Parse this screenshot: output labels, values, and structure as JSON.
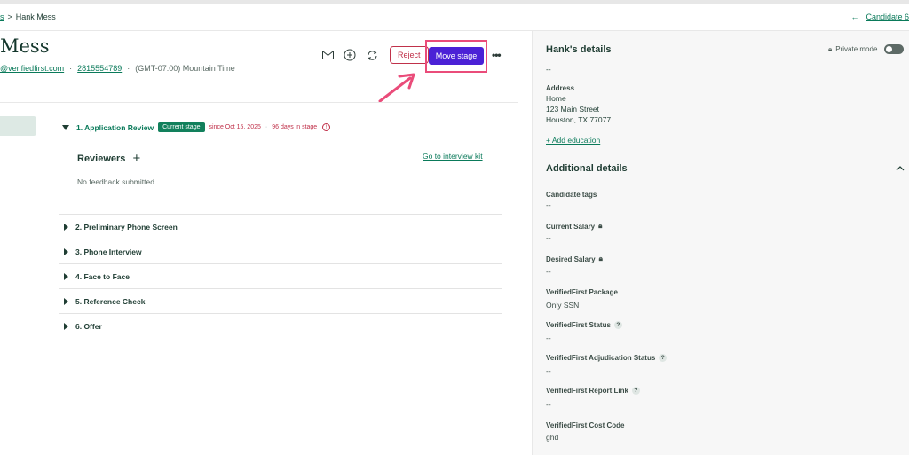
{
  "breadcrumb": {
    "parent": "s",
    "separator": ">",
    "current": "Hank Mess"
  },
  "next_candidate": {
    "label": "Candidate 6"
  },
  "candidate": {
    "name": "Mess",
    "email": "@verifiedfirst.com",
    "phone": "2815554789",
    "timezone": "(GMT-07:00) Mountain Time"
  },
  "actions": {
    "reject": "Reject",
    "move_stage": "Move stage",
    "more": "•••"
  },
  "stage": {
    "title": "1. Application Review",
    "badge": "Current stage",
    "since": "since Oct 15, 2025",
    "days": "96 days in stage",
    "info_symbol": "!"
  },
  "reviewers": {
    "label": "Reviewers",
    "add": "+",
    "kit_link": "Go to interview kit",
    "no_feedback": "No feedback submitted"
  },
  "stages": [
    "2. Preliminary Phone Screen",
    "3. Phone Interview",
    "4. Face to Face",
    "5. Reference Check",
    "6. Offer"
  ],
  "details": {
    "title": "Hank's details",
    "private_mode": "Private mode",
    "dash": "--",
    "address_label": "Address",
    "address_type": "Home",
    "address_line1": "123 Main Street",
    "address_line2": "Houston, TX 77077",
    "add_education": "+ Add education"
  },
  "additional": {
    "title": "Additional details",
    "fields": [
      {
        "label": "Candidate tags",
        "value": "--"
      },
      {
        "label": "Current Salary",
        "value": "--"
      },
      {
        "label": "Desired Salary",
        "value": "--"
      },
      {
        "label": "VerifiedFirst Package",
        "value": "Only SSN"
      },
      {
        "label": "VerifiedFirst Status",
        "value": "--"
      },
      {
        "label": "VerifiedFirst Adjudication Status",
        "value": "--"
      },
      {
        "label": "VerifiedFirst Report Link",
        "value": "--"
      },
      {
        "label": "VerifiedFirst Cost Code",
        "value": "ghd"
      }
    ],
    "help_symbol": "?"
  },
  "colors": {
    "primary": "#4b21d6",
    "highlight": "#ea4c7a",
    "danger": "#c0314a",
    "brand": "#12805c"
  }
}
